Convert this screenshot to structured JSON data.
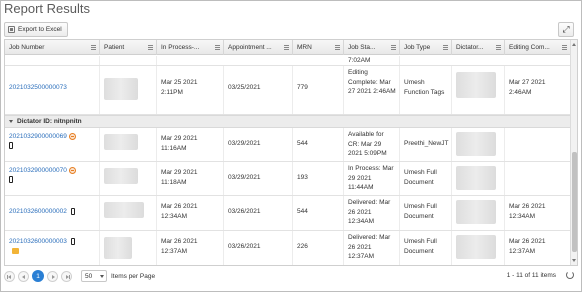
{
  "page": {
    "title": "Report Results"
  },
  "toolbar": {
    "export_label": "Export to Excel",
    "expand_icon": "expand-icon"
  },
  "columns": [
    "Job Number",
    "Patient",
    "In Process-...",
    "Appointment ...",
    "MRN",
    "Job Sta...",
    "Job Type",
    "Dictator...",
    "Editing Com..."
  ],
  "rows_top": [
    {
      "status": "7:02AM"
    },
    {
      "job_number": "2021032500000073",
      "in_process": "Mar 25 2021 2:11PM",
      "appointment": "03/25/2021",
      "mrn": "779",
      "status": "Editing Complete: Mar 27 2021 2:46AM",
      "job_type": "Umesh Function Tags",
      "editing_complete": "Mar 27 2021 2:46AM"
    }
  ],
  "group": {
    "label": "Dictator ID: nitnpnitn"
  },
  "rows": [
    {
      "job_number": "2021032900000069",
      "in_process": "Mar 29 2021 11:16AM",
      "appointment": "03/29/2021",
      "mrn": "544",
      "status": "Available for CR: Mar 29 2021 5:09PM",
      "job_type": "Preethi_NewJT",
      "editing_complete": ""
    },
    {
      "job_number": "2021032900000070",
      "in_process": "Mar 29 2021 11:18AM",
      "appointment": "03/29/2021",
      "mrn": "193",
      "status": "In Process: Mar 29 2021 11:44AM",
      "job_type": "Umesh Full Document",
      "editing_complete": ""
    },
    {
      "job_number": "2021032600000002",
      "in_process": "Mar 26 2021 12:34AM",
      "appointment": "03/26/2021",
      "mrn": "544",
      "status": "Delivered: Mar 26 2021 12:34AM",
      "job_type": "Umesh Full Document",
      "editing_complete": "Mar 26 2021 12:34AM"
    },
    {
      "job_number": "2021032600000003",
      "in_process": "Mar 26 2021 12:37AM",
      "appointment": "03/26/2021",
      "mrn": "226",
      "status": "Delivered: Mar 26 2021 12:37AM",
      "job_type": "Umesh Full Document",
      "editing_complete": "Mar 26 2021 12:37AM"
    }
  ],
  "pager": {
    "current_page": "1",
    "page_size": "50",
    "items_per_page": "Items per Page",
    "info": "1 - 11 of 11 items"
  }
}
